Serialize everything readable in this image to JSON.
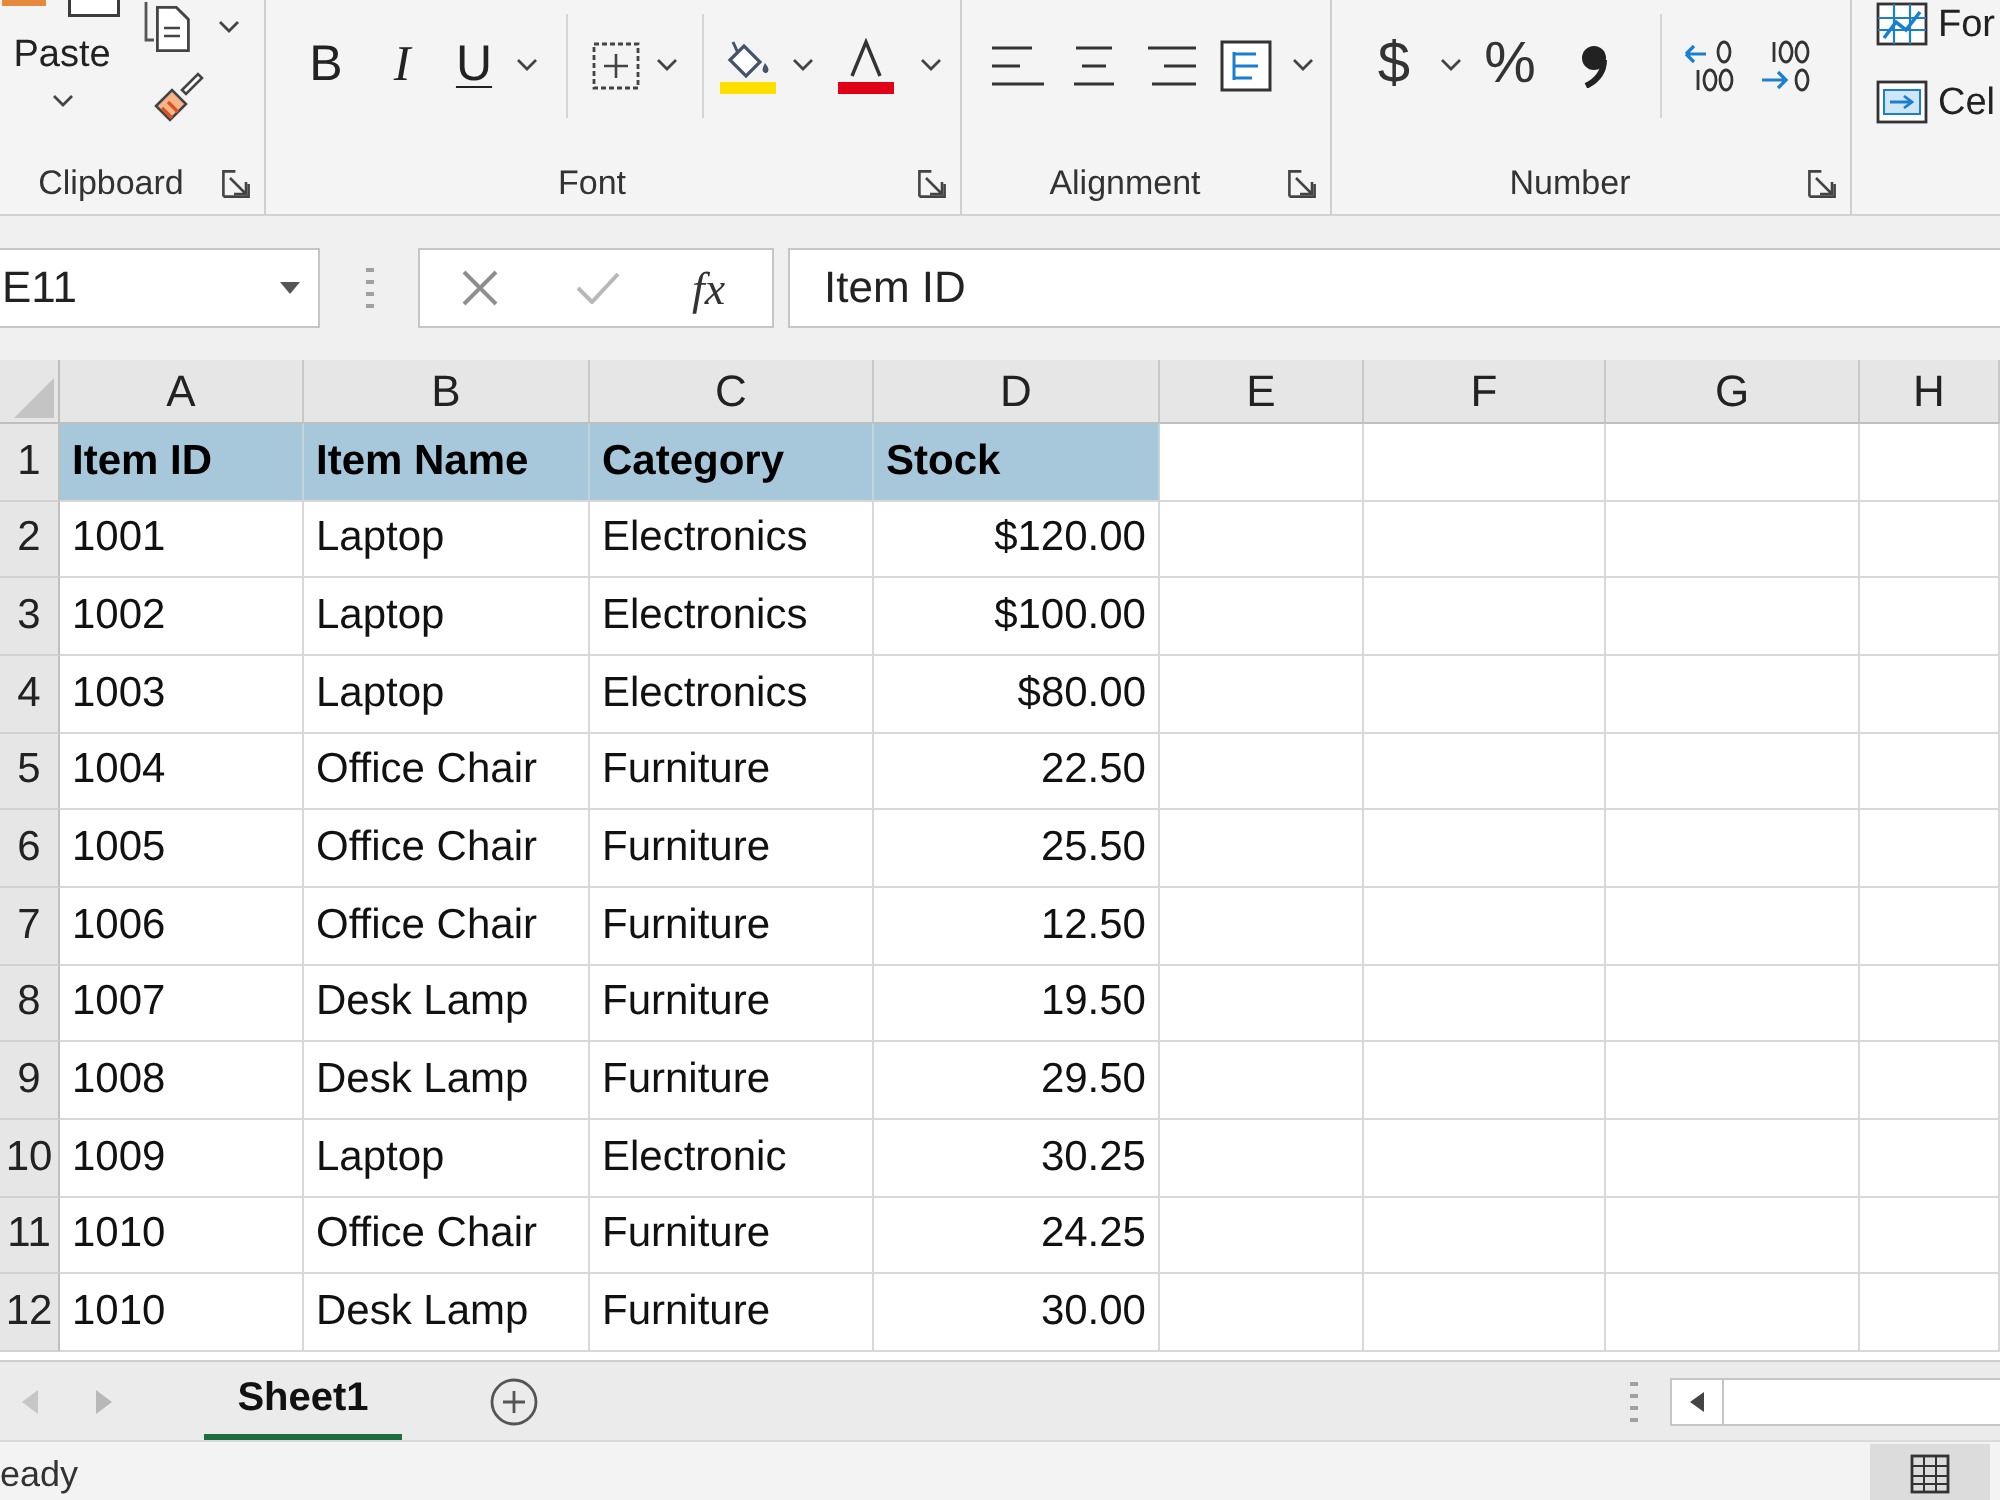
{
  "ribbon": {
    "groups": [
      {
        "kind": "clipboard",
        "label": "Clipboard",
        "launcher": true,
        "paste_label": "Paste"
      },
      {
        "kind": "font",
        "label": "Font",
        "launcher": true,
        "bold": "B",
        "italic": "I",
        "underline": "U"
      },
      {
        "kind": "alignment",
        "label": "Alignment",
        "launcher": true
      },
      {
        "kind": "number",
        "label": "Number",
        "launcher": true,
        "currency": "$",
        "percent": "%"
      },
      {
        "kind": "styles",
        "commands": [
          "For",
          "Cel"
        ]
      }
    ]
  },
  "formula_bar": {
    "name_box": "E11",
    "function_button": "fx",
    "formula": "Item ID"
  },
  "sheet": {
    "columns": [
      {
        "label": "A",
        "kind": "text"
      },
      {
        "label": "B",
        "kind": "text"
      },
      {
        "label": "C",
        "kind": "text"
      },
      {
        "label": "D",
        "kind": "number"
      },
      {
        "label": "E"
      },
      {
        "label": "F"
      },
      {
        "label": "G"
      },
      {
        "label": "H"
      }
    ],
    "rows": [
      {
        "label": "1",
        "kind": "header",
        "cells": [
          "Item ID",
          "Item Name",
          "Category",
          "Stock"
        ]
      },
      {
        "label": "2",
        "kind": "data",
        "cells": [
          "1001",
          "Laptop",
          "Electronics",
          "$120.00"
        ]
      },
      {
        "label": "3",
        "kind": "data",
        "cells": [
          "1002",
          "Laptop",
          "Electronics",
          "$100.00"
        ]
      },
      {
        "label": "4",
        "kind": "data",
        "cells": [
          "1003",
          "Laptop",
          "Electronics",
          "$80.00"
        ]
      },
      {
        "label": "5",
        "kind": "data",
        "cells": [
          "1004",
          "Office Chair",
          "Furniture",
          "22.50"
        ]
      },
      {
        "label": "6",
        "kind": "data",
        "cells": [
          "1005",
          "Office Chair",
          "Furniture",
          "25.50"
        ]
      },
      {
        "label": "7",
        "kind": "data",
        "cells": [
          "1006",
          "Office Chair",
          "Furniture",
          "12.50"
        ]
      },
      {
        "label": "8",
        "kind": "data",
        "cells": [
          "1007",
          "Desk Lamp",
          "Furniture",
          "19.50"
        ]
      },
      {
        "label": "9",
        "kind": "data",
        "cells": [
          "1008",
          "Desk Lamp",
          "Furniture",
          "29.50"
        ]
      },
      {
        "label": "10",
        "kind": "data",
        "cells": [
          "1009",
          "Laptop",
          "Electronic",
          "30.25"
        ]
      },
      {
        "label": "11",
        "kind": "data",
        "cells": [
          "1010",
          "Office Chair",
          "Furniture",
          "24.25"
        ]
      },
      {
        "label": "12",
        "kind": "data",
        "cells": [
          "1010",
          "Desk Lamp",
          "Furniture",
          "30.00"
        ]
      }
    ]
  },
  "sheet_tabs": [
    {
      "label": "Sheet1",
      "selected": true
    }
  ],
  "status_bar": {
    "text": "eady"
  }
}
